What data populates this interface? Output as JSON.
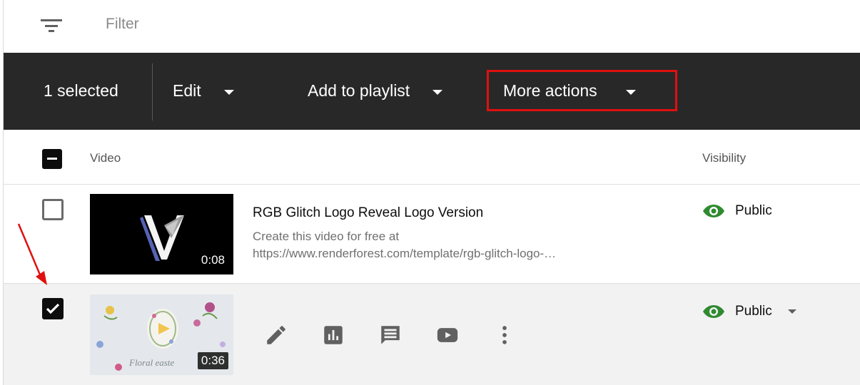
{
  "filter": {
    "placeholder": "Filter",
    "icon": "filter-list-icon"
  },
  "action_bar": {
    "selected_count": "1 selected",
    "edit_label": "Edit",
    "playlist_label": "Add to playlist",
    "more_label": "More actions",
    "highlight_color": "#e01010"
  },
  "table": {
    "headers": {
      "video": "Video",
      "visibility": "Visibility"
    },
    "rows": [
      {
        "selected": false,
        "title": "RGB Glitch Logo Reveal Logo Version",
        "description_line1": "Create this video for free at",
        "description_line2": "https://www.renderforest.com/template/rgb-glitch-logo-…",
        "duration": "0:08",
        "visibility": "Public"
      },
      {
        "selected": true,
        "title": "",
        "duration": "0:36",
        "thumbnail_text": "Floral easte",
        "visibility": "Public",
        "tools": [
          "pencil-icon",
          "analytics-icon",
          "comments-icon",
          "youtube-icon",
          "more-vert-icon"
        ]
      }
    ]
  },
  "colors": {
    "bar_bg": "#282828",
    "public_green": "#2f8a2f",
    "annotation_arrow": "#e01010"
  }
}
